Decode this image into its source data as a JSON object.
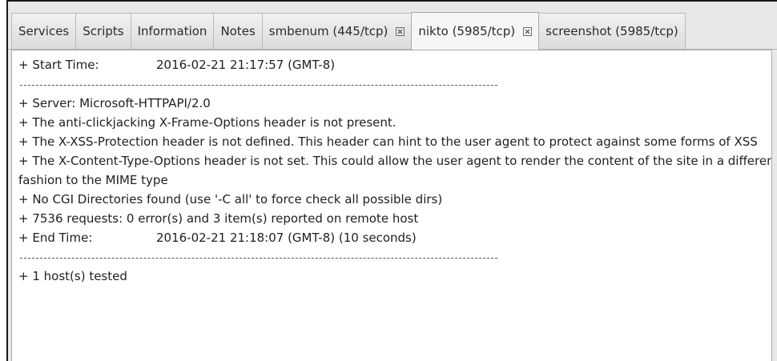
{
  "tabs": [
    {
      "label": "Services",
      "closable": false,
      "active": false
    },
    {
      "label": "Scripts",
      "closable": false,
      "active": false
    },
    {
      "label": "Information",
      "closable": false,
      "active": false
    },
    {
      "label": "Notes",
      "closable": false,
      "active": false
    },
    {
      "label": "smbenum (445/tcp)",
      "closable": true,
      "active": false
    },
    {
      "label": "nikto (5985/tcp)",
      "closable": true,
      "active": true
    },
    {
      "label": "screenshot (5985/tcp)",
      "closable": false,
      "active": false
    }
  ],
  "output": {
    "start_label": "+ Start Time:",
    "start_value": "2016-02-21 21:17:57 (GMT-8)",
    "server": "+ Server: Microsoft-HTTPAPI/2.0",
    "anti_clickjacking": "+ The anti-clickjacking X-Frame-Options header is not present.",
    "xss_protection": "+ The X-XSS-Protection header is not defined. This header can hint to the user agent to protect against some forms of XSS",
    "content_type": "+ The X-Content-Type-Options header is not set. This could allow the user agent to render the content of the site in a different fashion to the MIME type",
    "cgi": "+ No CGI Directories found (use '-C all' to force check all possible dirs)",
    "requests": "+ 7536 requests: 0 error(s) and 3 item(s) reported on remote host",
    "end_label": "+ End Time:",
    "end_value": "2016-02-21 21:18:07 (GMT-8) (10 seconds)",
    "hosts_tested": "+ 1 host(s) tested"
  }
}
